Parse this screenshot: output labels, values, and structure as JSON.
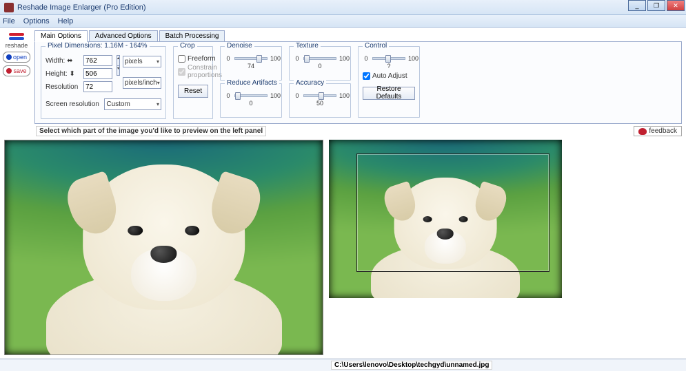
{
  "window": {
    "title": "Reshade Image Enlarger (Pro Edition)"
  },
  "menu": {
    "file": "File",
    "options": "Options",
    "help": "Help"
  },
  "sidebar": {
    "brand": "reshade",
    "open": "open",
    "save": "save"
  },
  "tabs": {
    "main": "Main Options",
    "adv": "Advanced Options",
    "batch": "Batch Processing"
  },
  "pixeldim": {
    "title": "Pixel Dimensions: 1.16M - 164%",
    "width_lbl": "Width: ⬌",
    "width_val": "762",
    "height_lbl": "Height: ⬍",
    "height_val": "506",
    "res_lbl": "Resolution",
    "res_val": "72",
    "unit_px": "pixels",
    "unit_ppi": "pixels/inch",
    "screen_lbl": "Screen resolution",
    "screen_val": "Custom"
  },
  "crop": {
    "title": "Crop",
    "freeform": "Freeform",
    "constrain": "Constrain proportions",
    "reset": "Reset"
  },
  "denoise": {
    "title": "Denoise",
    "min": "0",
    "max": "100",
    "val": "74"
  },
  "reduce": {
    "title": "Reduce Artifacts",
    "min": "0",
    "max": "100",
    "val": "0"
  },
  "texture": {
    "title": "Texture",
    "min": "0",
    "max": "100",
    "val": "0"
  },
  "accuracy": {
    "title": "Accuracy",
    "min": "0",
    "max": "100",
    "val": "50"
  },
  "control": {
    "title": "Control",
    "min": "0",
    "max": "100",
    "val": "?",
    "auto": "Auto Adjust",
    "restore": "Restore Defaults"
  },
  "instruction": "Select which part of the image you'd like to preview on the left panel",
  "feedback": "feedback",
  "status_path": "C:\\Users\\lenovo\\Desktop\\techgyd\\unnamed.jpg"
}
